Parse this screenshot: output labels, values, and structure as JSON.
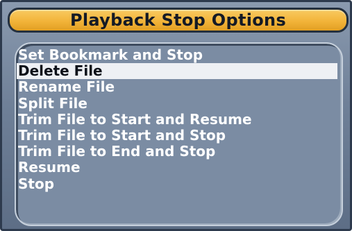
{
  "dialog": {
    "title": "Playback Stop Options",
    "selected_index": 1,
    "items": [
      {
        "label": "Set Bookmark and Stop"
      },
      {
        "label": "Delete File"
      },
      {
        "label": "Rename File"
      },
      {
        "label": "Split File"
      },
      {
        "label": "Trim File to Start and Resume"
      },
      {
        "label": "Trim File to Start and Stop"
      },
      {
        "label": "Trim File to End and Stop"
      },
      {
        "label": "Resume"
      },
      {
        "label": "Stop"
      }
    ]
  },
  "colors": {
    "title_bar": "#f2b43a",
    "panel": "#7b8ca3",
    "highlight": "#eef0f4",
    "text": "#ffffff"
  }
}
